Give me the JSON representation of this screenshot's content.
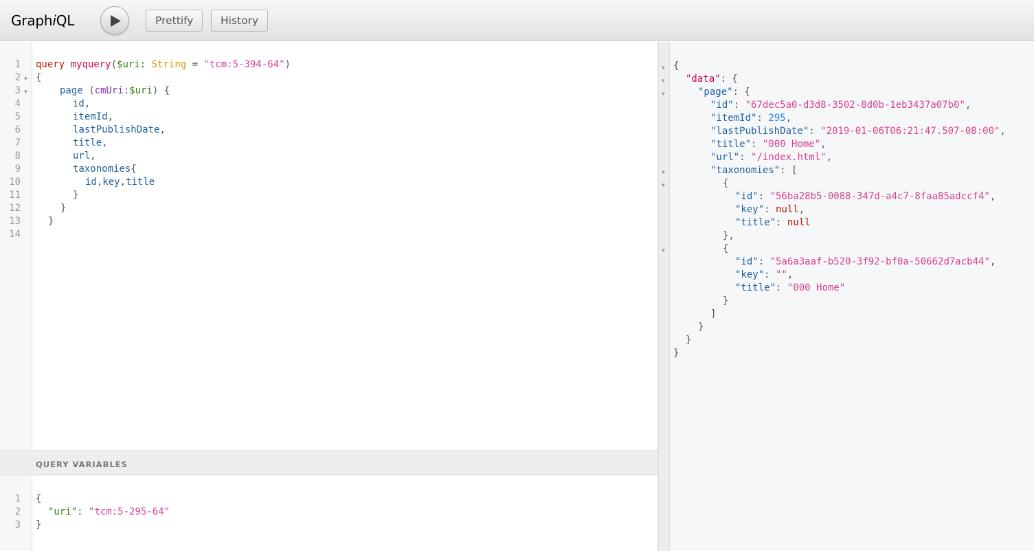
{
  "app": {
    "logo_prefix": "Graph",
    "logo_italic": "i",
    "logo_suffix": "QL"
  },
  "toolbar": {
    "run_icon": "play-icon",
    "prettify_label": "Prettify",
    "history_label": "History"
  },
  "query_editor": {
    "line_numbers": [
      "1",
      "2",
      "3",
      "4",
      "5",
      "6",
      "7",
      "8",
      "9",
      "10",
      "11",
      "12",
      "13",
      "14"
    ],
    "tokens": {
      "l1_kw": "query",
      "l1_name": "myquery",
      "l1_open": "(",
      "l1_var": "$uri",
      "l1_colon": ": ",
      "l1_type": "String",
      "l1_eq": " = ",
      "l1_str": "\"tcm:5-394-64\"",
      "l1_close": ")",
      "l2": "{",
      "l3_field": "page",
      "l3_open": " (",
      "l3_arg": "cmUri",
      "l3_colon": ":",
      "l3_var": "$uri",
      "l3_close": ") {",
      "l4": "id",
      "l5": "itemId",
      "l6": "lastPublishDate",
      "l7": "title",
      "l8": "url",
      "l9": "taxonomies",
      "l10_a": "id",
      "l10_b": "key",
      "l10_c": "title",
      "comma": ",",
      "open_brace": "{",
      "close_brace": "}"
    }
  },
  "variables": {
    "title": "QUERY VARIABLES",
    "line_numbers": [
      "1",
      "2",
      "3"
    ],
    "open": "{",
    "key": "\"uri\"",
    "colon": ": ",
    "value": "\"tcm:5-295-64\"",
    "close": "}"
  },
  "result": {
    "data_key": "\"data\"",
    "page_key": "\"page\"",
    "fields": {
      "id_key": "\"id\"",
      "id_val": "\"67dec5a0-d3d8-3502-8d0b-1eb3437a07b0\"",
      "itemId_key": "\"itemId\"",
      "itemId_val": "295",
      "lastPublishDate_key": "\"lastPublishDate\"",
      "lastPublishDate_val": "\"2019-01-06T06:21:47.507-08:00\"",
      "title_key": "\"title\"",
      "title_val": "\"000 Home\"",
      "url_key": "\"url\"",
      "url_val": "\"/index.html\"",
      "taxonomies_key": "\"taxonomies\""
    },
    "taxonomies": [
      {
        "id_key": "\"id\"",
        "id_val": "\"56ba28b5-0088-347d-a4c7-8faa85adccf4\"",
        "key_key": "\"key\"",
        "key_val": "null",
        "title_key": "\"title\"",
        "title_val": "null"
      },
      {
        "id_key": "\"id\"",
        "id_val": "\"5a6a3aaf-b520-3f92-bf0a-50662d7acb44\"",
        "key_key": "\"key\"",
        "key_val": "\"\"",
        "title_key": "\"title\"",
        "title_val": "\"000 Home\""
      }
    ],
    "punct": {
      "open_brace": "{",
      "close_brace": "}",
      "open_bracket": "[",
      "close_bracket": "]",
      "colon": ": ",
      "comma": ",",
      "colon_brace": ": {",
      "colon_bracket": ": [",
      "close_brace_comma": "},"
    }
  }
}
